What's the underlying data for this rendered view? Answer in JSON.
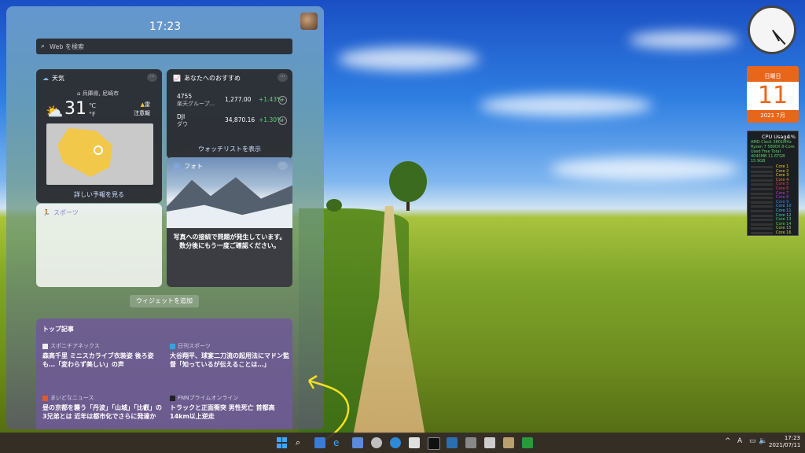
{
  "panel": {
    "time": "17:23",
    "search_placeholder": "Web を検索"
  },
  "weather": {
    "title": "天気",
    "location": "兵庫県, 尼崎市",
    "temperature": "31",
    "unit_c": "℃",
    "unit_f": "°F",
    "alert_line1": "雷",
    "alert_line2": "注意報",
    "link": "詳しい予報を見る"
  },
  "watchlist": {
    "title": "あなたへのおすすめ",
    "stocks": [
      {
        "ticker": "4755",
        "name": "楽天グループ...",
        "price": "1,277.00",
        "change": "+1.43%"
      },
      {
        "ticker": "DJI",
        "name": "ダウ",
        "price": "34,870.16",
        "change": "+1.30%"
      }
    ],
    "link": "ウォッチリストを表示"
  },
  "sports": {
    "title": "スポーツ"
  },
  "photo": {
    "title": "フォト",
    "message": "写真への接続で問題が発生しています。数分後にもう一度ご確認ください。"
  },
  "add_widget": "ウィジェットを追加",
  "top_stories": {
    "title": "トップ記事",
    "stories": [
      {
        "source": "スポニチアネックス",
        "headline": "森高千里 ミニスカライブ衣装姿 後ろ姿も…「変わらず美しい」の声"
      },
      {
        "source": "日刊スポーツ",
        "headline": "大谷翔平、球宴二刀流の起用法にマドン監督「知っているが伝えることは…」"
      },
      {
        "source": "まいどなニュース",
        "headline": "昼の京都を襲う「丹波」「山城」「比叡」の3兄弟とは 近年は都市化でさらに発達か"
      },
      {
        "source": "FNNプライムオンライン",
        "headline": "トラックと正面衝突 男性死亡 首都高14km以上逆走"
      }
    ]
  },
  "calendar": {
    "weekday": "日曜日",
    "day": "11",
    "month": "2021 7月"
  },
  "cpu": {
    "title": "CPU Usage",
    "percent": "1%",
    "sub_line1": "AMD  Clock 3801MHz",
    "sub_line2": "Ryzen 7 5800X 8-Core",
    "sub_line3": "Used  Free  Total",
    "sub_line4": "4043MB 11.6TGB 15.9GB",
    "cores": [
      "Core 1",
      "Core 2",
      "Core 3",
      "Core 4",
      "Core 5",
      "Core 6",
      "Core 7",
      "Core 8",
      "Core 9",
      "Core 10",
      "Core 11",
      "Core 12",
      "Core 13",
      "Core 14",
      "Core 15",
      "Core 16"
    ]
  },
  "taskbar": {
    "time": "17:23",
    "date": "2021/07/11",
    "tray_chevron": "^",
    "ime": "A"
  }
}
